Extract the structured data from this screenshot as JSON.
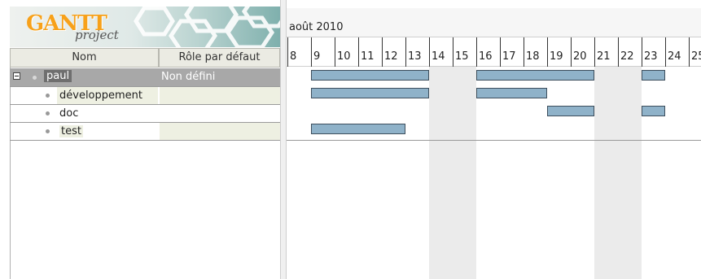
{
  "logo": {
    "text": "GANTT",
    "sub": "project"
  },
  "columns": {
    "name": "Nom",
    "role": "Rôle par défaut"
  },
  "resources": [
    {
      "name": "paul",
      "role": "Non défini",
      "level": 0,
      "expanded": true
    },
    {
      "name": "développement",
      "role": "",
      "level": 1
    },
    {
      "name": "doc",
      "role": "",
      "level": 1
    },
    {
      "name": "test",
      "role": "",
      "level": 1
    }
  ],
  "chart": {
    "month": "août 2010",
    "days": [
      "8",
      "9",
      "10",
      "11",
      "12",
      "13",
      "14",
      "15",
      "16",
      "17",
      "18",
      "19",
      "20",
      "21",
      "22",
      "23",
      "24",
      "25"
    ],
    "weekend_days": [
      "14",
      "15",
      "21",
      "22"
    ],
    "rows": [
      {
        "bars": [
          {
            "from": "9",
            "to": "13"
          },
          {
            "from": "16",
            "to": "20"
          },
          {
            "from": "23",
            "to": "23"
          }
        ]
      },
      {
        "bars": [
          {
            "from": "9",
            "to": "13"
          },
          {
            "from": "16",
            "to": "18"
          }
        ]
      },
      {
        "bars": [
          {
            "from": "19",
            "to": "20"
          },
          {
            "from": "23",
            "to": "23"
          }
        ]
      },
      {
        "bars": [
          {
            "from": "9",
            "to": "12"
          }
        ]
      }
    ]
  },
  "colors": {
    "bar_fill": "#8fb2c9",
    "bar_border": "#3d4e5c",
    "selected_row": "#a8a8a8",
    "selected_label": "#6f6f6f",
    "child_row": "#eef0e2",
    "weekend": "#ebebeb"
  }
}
